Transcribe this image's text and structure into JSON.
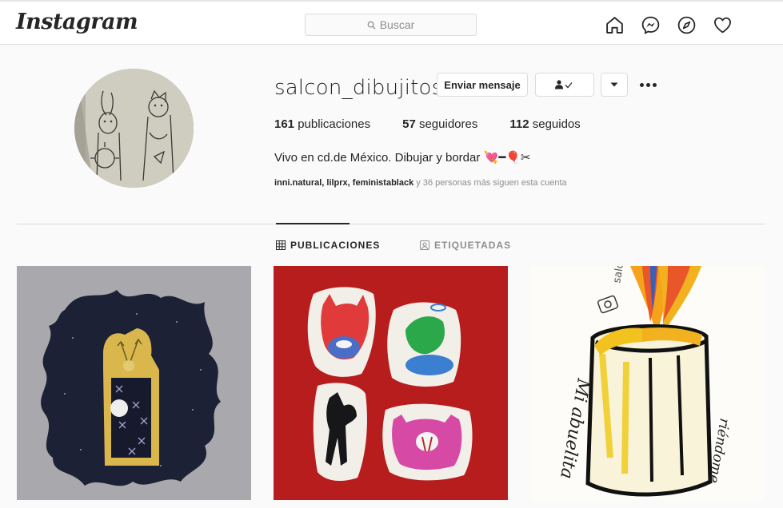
{
  "nav": {
    "logo": "Instagram",
    "search_placeholder": "Buscar",
    "icons": [
      "home-icon",
      "messenger-icon",
      "explore-icon",
      "activity-heart-icon"
    ]
  },
  "profile": {
    "username": "salcon_dibujitos",
    "message_button": "Enviar mensaje",
    "following_icon": "person-check-icon",
    "dropdown_icon": "caret-down-icon",
    "more_icon": "more-options-icon",
    "stats": {
      "posts_count": "161",
      "posts_label": "publicaciones",
      "followers_count": "57",
      "followers_label": "seguidores",
      "following_count": "112",
      "following_label": "seguidos"
    },
    "bio": "Vivo en cd.de México. Dibujar y bordar 💘━🎈✂",
    "followed_by": {
      "accounts": "inni.natural, lilprx, feministablack",
      "rest": " y 36 personas más siguen esta cuenta"
    }
  },
  "tabs": [
    {
      "label": "PUBLICACIONES",
      "active": true
    },
    {
      "label": "ETIQUETADAS",
      "active": false
    }
  ],
  "posts": [
    {
      "subject": "embroidered-patch"
    },
    {
      "subject": "sticker-drawings"
    },
    {
      "subject": "marker-drawing"
    }
  ],
  "post3": {
    "side_text": "salcon",
    "caption_text": "Mi abuelita",
    "caption_text2": "riéndome"
  },
  "colors": {
    "border": "#dbdbdb",
    "text": "#262626",
    "muted": "#8e8e8e",
    "background": "#fafafa"
  }
}
